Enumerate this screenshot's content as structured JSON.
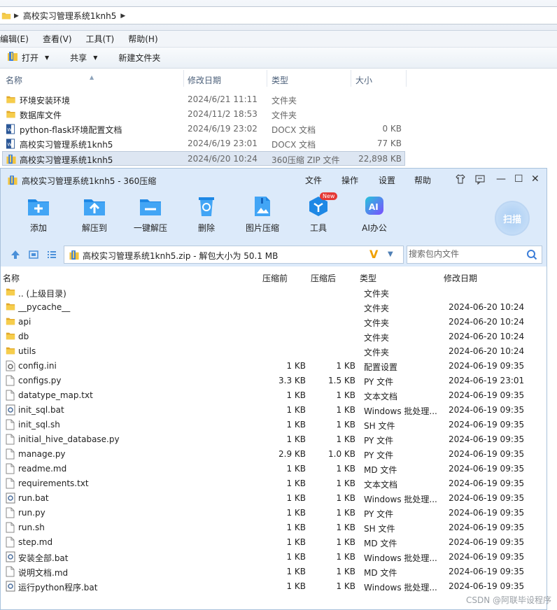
{
  "explorer": {
    "breadcrumb": "高校实习管理系统1knh5",
    "menu": [
      "编辑(E)",
      "查看(V)",
      "工具(T)",
      "帮助(H)"
    ],
    "toolbar": {
      "open": "打开",
      "share": "共享",
      "new_folder": "新建文件夹"
    },
    "columns": {
      "name": "名称",
      "date": "修改日期",
      "type": "类型",
      "size": "大小"
    },
    "rows": [
      {
        "name": "环境安装环境",
        "date": "2024/6/21 11:11",
        "type": "文件夹",
        "size": "",
        "icon": "folder-icon"
      },
      {
        "name": "数据库文件",
        "date": "2024/11/2 18:53",
        "type": "文件夹",
        "size": "",
        "icon": "folder-icon"
      },
      {
        "name": "python-flask环境配置文档",
        "date": "2024/6/19 23:02",
        "type": "DOCX 文档",
        "size": "0 KB",
        "icon": "word-doc-icon"
      },
      {
        "name": "高校实习管理系统1knh5",
        "date": "2024/6/19 23:01",
        "type": "DOCX 文档",
        "size": "77 KB",
        "icon": "word-doc-icon"
      },
      {
        "name": "高校实习管理系统1knh5",
        "date": "2024/6/20 10:24",
        "type": "360压缩 ZIP 文件",
        "size": "22,898 KB",
        "icon": "zip-archive-icon"
      }
    ]
  },
  "zip": {
    "title": "高校实习管理系统1knh5 - 360压缩",
    "menu": [
      "文件",
      "操作",
      "设置",
      "帮助"
    ],
    "tools": [
      "添加",
      "解压到",
      "一键解压",
      "删除",
      "图片压缩",
      "工具",
      "AI办公"
    ],
    "new_badge": "New",
    "ai_text": "AI",
    "scan_label": "扫描",
    "path": "高校实习管理系统1knh5.zip - 解包大小为 50.1 MB",
    "search_placeholder": "搜索包内文件",
    "columns": {
      "name": "名称",
      "before": "压缩前",
      "after": "压缩后",
      "type": "类型",
      "date": "修改日期"
    },
    "rows": [
      {
        "name": ".. (上级目录)",
        "before": "",
        "after": "",
        "type": "文件夹",
        "date": "",
        "icon": "folder"
      },
      {
        "name": "__pycache__",
        "before": "",
        "after": "",
        "type": "文件夹",
        "date": "2024-06-20 10:24",
        "icon": "folder"
      },
      {
        "name": "api",
        "before": "",
        "after": "",
        "type": "文件夹",
        "date": "2024-06-20 10:24",
        "icon": "folder"
      },
      {
        "name": "db",
        "before": "",
        "after": "",
        "type": "文件夹",
        "date": "2024-06-20 10:24",
        "icon": "folder"
      },
      {
        "name": "utils",
        "before": "",
        "after": "",
        "type": "文件夹",
        "date": "2024-06-20 10:24",
        "icon": "folder"
      },
      {
        "name": "config.ini",
        "before": "1 KB",
        "after": "1 KB",
        "type": "配置设置",
        "date": "2024-06-19 09:35",
        "icon": "gear"
      },
      {
        "name": "configs.py",
        "before": "3.3 KB",
        "after": "1.5 KB",
        "type": "PY 文件",
        "date": "2024-06-19 23:01",
        "icon": "file"
      },
      {
        "name": "datatype_map.txt",
        "before": "1 KB",
        "after": "1 KB",
        "type": "文本文档",
        "date": "2024-06-19 09:35",
        "icon": "file"
      },
      {
        "name": "init_sql.bat",
        "before": "1 KB",
        "after": "1 KB",
        "type": "Windows 批处理...",
        "date": "2024-06-19 09:35",
        "icon": "bat"
      },
      {
        "name": "init_sql.sh",
        "before": "1 KB",
        "after": "1 KB",
        "type": "SH 文件",
        "date": "2024-06-19 09:35",
        "icon": "file"
      },
      {
        "name": "initial_hive_database.py",
        "before": "1 KB",
        "after": "1 KB",
        "type": "PY 文件",
        "date": "2024-06-19 09:35",
        "icon": "file"
      },
      {
        "name": "manage.py",
        "before": "2.9 KB",
        "after": "1.0 KB",
        "type": "PY 文件",
        "date": "2024-06-19 09:35",
        "icon": "file"
      },
      {
        "name": "readme.md",
        "before": "1 KB",
        "after": "1 KB",
        "type": "MD 文件",
        "date": "2024-06-19 09:35",
        "icon": "file"
      },
      {
        "name": "requirements.txt",
        "before": "1 KB",
        "after": "1 KB",
        "type": "文本文档",
        "date": "2024-06-19 09:35",
        "icon": "file"
      },
      {
        "name": "run.bat",
        "before": "1 KB",
        "after": "1 KB",
        "type": "Windows 批处理...",
        "date": "2024-06-19 09:35",
        "icon": "bat"
      },
      {
        "name": "run.py",
        "before": "1 KB",
        "after": "1 KB",
        "type": "PY 文件",
        "date": "2024-06-19 09:35",
        "icon": "file"
      },
      {
        "name": "run.sh",
        "before": "1 KB",
        "after": "1 KB",
        "type": "SH 文件",
        "date": "2024-06-19 09:35",
        "icon": "file"
      },
      {
        "name": "step.md",
        "before": "1 KB",
        "after": "1 KB",
        "type": "MD 文件",
        "date": "2024-06-19 09:35",
        "icon": "file"
      },
      {
        "name": "安装全部.bat",
        "before": "1 KB",
        "after": "1 KB",
        "type": "Windows 批处理...",
        "date": "2024-06-19 09:35",
        "icon": "bat"
      },
      {
        "name": "说明文档.md",
        "before": "1 KB",
        "after": "1 KB",
        "type": "MD 文件",
        "date": "2024-06-19 09:35",
        "icon": "file"
      },
      {
        "name": "运行python程序.bat",
        "before": "1 KB",
        "after": "1 KB",
        "type": "Windows 批处理...",
        "date": "2024-06-19 09:35",
        "icon": "bat"
      }
    ]
  },
  "watermark": "CSDN @阿联毕设程序"
}
